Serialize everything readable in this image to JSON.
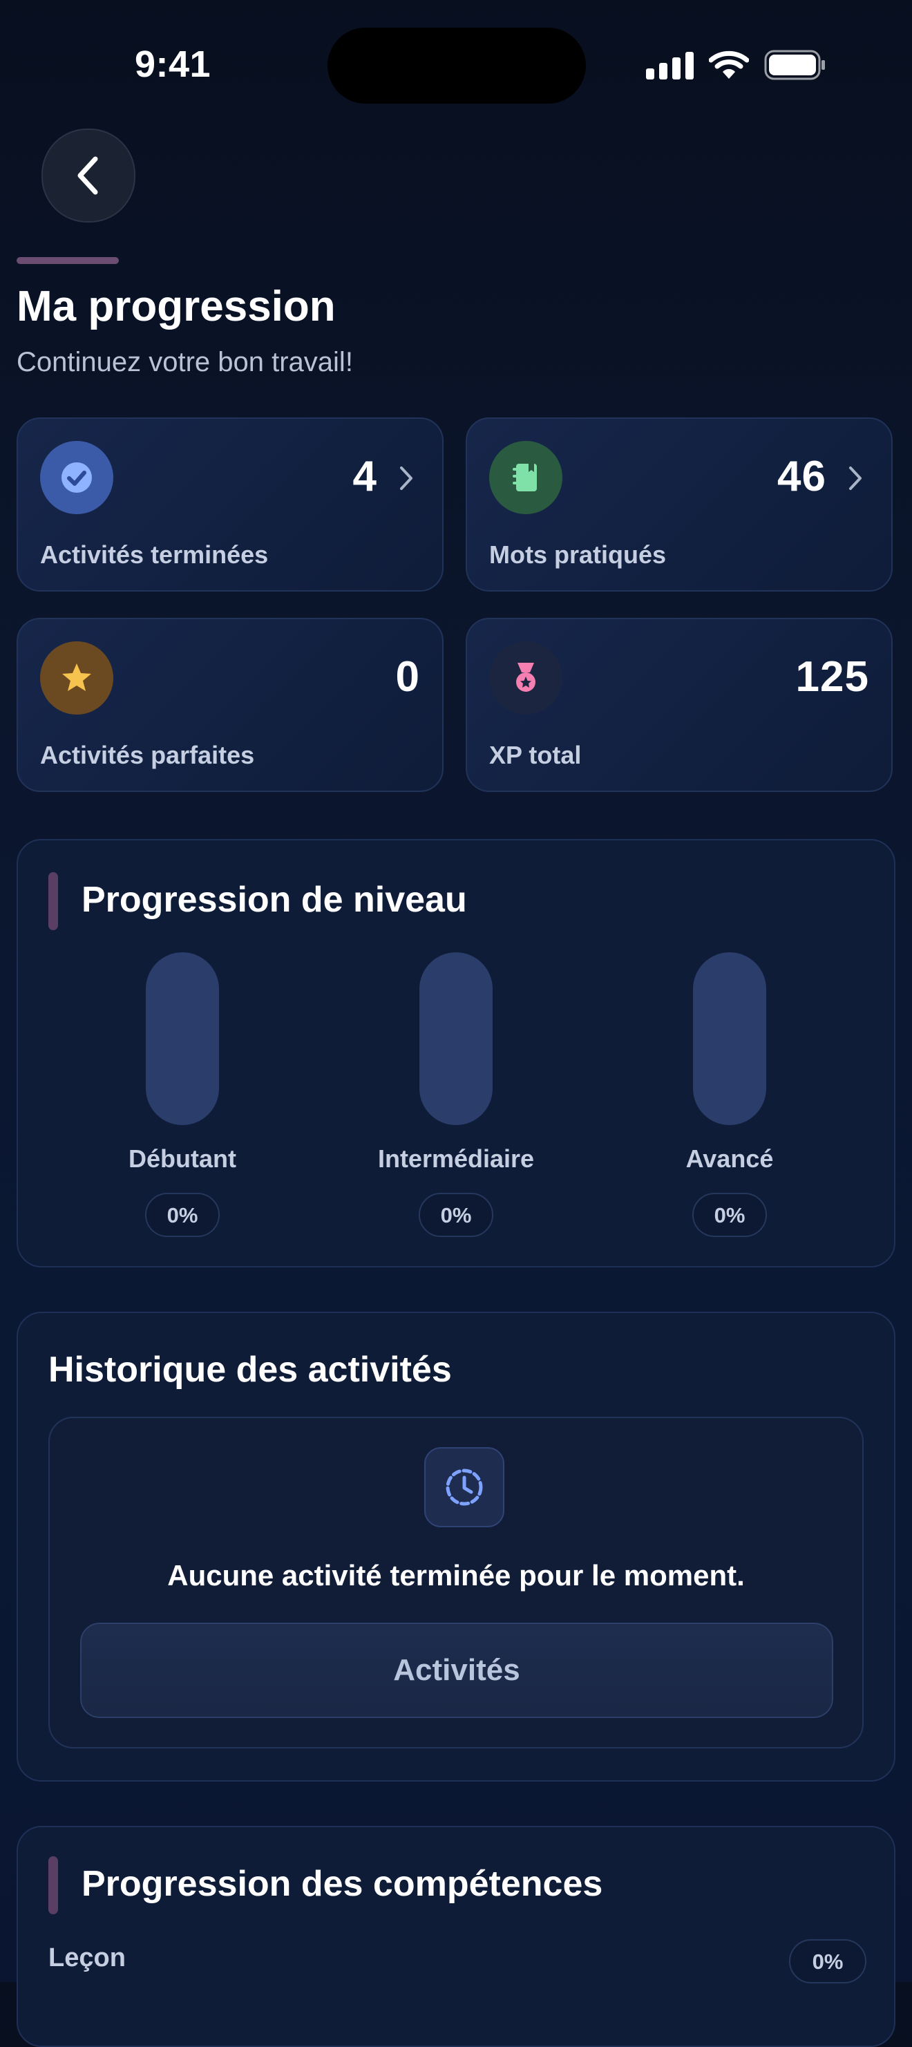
{
  "status_bar": {
    "time": "9:41",
    "icons": [
      "signal-icon",
      "wifi-icon",
      "battery-icon"
    ]
  },
  "header": {
    "back_icon": "chevron-left-icon",
    "title": "Ma progression",
    "subtitle": "Continuez votre bon travail!"
  },
  "stats": [
    {
      "label": "Activités terminées",
      "value": "4",
      "icon": "check-circle-icon",
      "icon_bg": "#3b5aa8",
      "icon_color": "#8fb3ff",
      "has_chevron": true
    },
    {
      "label": "Mots pratiqués",
      "value": "46",
      "icon": "notebook-icon",
      "icon_bg": "#2a5a40",
      "icon_color": "#7fe0a8",
      "has_chevron": true
    },
    {
      "label": "Activités parfaites",
      "value": "0",
      "icon": "star-icon",
      "icon_bg": "#6b4a22",
      "icon_color": "#f6c34e",
      "has_chevron": false
    },
    {
      "label": "XP total",
      "value": "125",
      "icon": "medal-icon",
      "icon_bg": "#1b2540",
      "icon_color": "#f47fb0",
      "has_chevron": false
    }
  ],
  "level_progress": {
    "title": "Progression de niveau",
    "levels": [
      {
        "label": "Débutant",
        "percent_text": "0%",
        "value": 0
      },
      {
        "label": "Intermédiaire",
        "percent_text": "0%",
        "value": 0
      },
      {
        "label": "Avancé",
        "percent_text": "0%",
        "value": 0
      }
    ]
  },
  "history": {
    "title": "Historique des activités",
    "icon": "clock-history-icon",
    "empty_text": "Aucune activité terminée pour le moment.",
    "button_label": "Activités"
  },
  "skills": {
    "title": "Progression des compétences",
    "rows": [
      {
        "label": "Leçon",
        "percent_text": "0%"
      }
    ]
  },
  "colors": {
    "accent": "#6b4d72",
    "card_border": "#213359",
    "bar": "#2b3d6b"
  }
}
